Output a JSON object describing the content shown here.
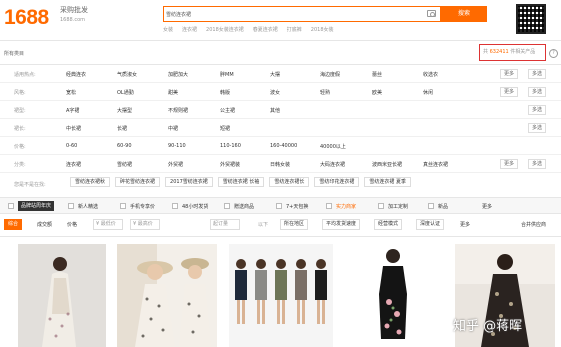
{
  "header": {
    "logo": "1688",
    "logo_sub": "采购批发",
    "logo_url": "1688.com",
    "search_value": "雪纺连衣裙",
    "search_button": "搜索",
    "hot_words": [
      "女装",
      "连衣裙",
      "2018女装连衣裙",
      "春夏连衣裙",
      "打底裤",
      "2018女装"
    ]
  },
  "results": {
    "all_categories": "所有类目",
    "count_prefix": "共",
    "count": "632411",
    "count_suffix": "件相关产品"
  },
  "filters": {
    "more": "更多",
    "multi": "多选",
    "rows": [
      {
        "label": "适用热点:",
        "items": [
          "经典连衣",
          "气质淑女",
          "加肥加大",
          "胖MM",
          "大摆",
          "海边度假",
          "蕾丝",
          "收选衣"
        ],
        "more": true,
        "multi": true
      },
      {
        "label": "风格:",
        "items": [
          "宽松",
          "OL通勤",
          "甜美",
          "韩版",
          "波女",
          "轻熟",
          "欧美",
          "休闲"
        ],
        "more": true,
        "multi": true
      },
      {
        "label": "裙型:",
        "items": [
          "A字裙",
          "大摆型",
          "不规则裙",
          "公主裙",
          "其他"
        ],
        "more": false,
        "multi": true
      },
      {
        "label": "裙长:",
        "items": [
          "中长裙",
          "长裙",
          "中裙",
          "短裙"
        ],
        "more": false,
        "multi": true
      },
      {
        "label": "价格:",
        "items": [
          "0-60",
          "60-90",
          "90-110",
          "110-160",
          "160-40000",
          "40000以上"
        ],
        "more": false,
        "multi": false
      },
      {
        "label": "分类:",
        "items": [
          "连衣裙",
          "雪纺裙",
          "外贸裙",
          "外贸裙装",
          "日韩女装",
          "大码连衣裙",
          "波西米亚长裙",
          "真丝连衣裙"
        ],
        "more": true,
        "multi": true
      }
    ],
    "seen_label": "您是不是在找:",
    "seen_items": [
      "雪纺连衣裙秋",
      "碎花雪纺连衣裙",
      "2017雪纺连衣裙",
      "雪纺连衣裙 长袖",
      "雪纺连衣裙长",
      "雪纺印花连衣裙",
      "雪纺连衣裙 夏季"
    ]
  },
  "services": {
    "badge": "品牌站周年庆",
    "items": [
      "新人精选",
      "手机专享价",
      "48小时发货",
      "赠送商品",
      "7+天包换",
      "实力商家",
      "加工定制",
      "新品"
    ],
    "more": "更多"
  },
  "sort": {
    "active": "综合",
    "items": [
      "成交额",
      "价格"
    ],
    "price_from": "¥ 最低价",
    "price_to": "¥ 最高价",
    "moq": "起订量",
    "moq_suffix": "以下",
    "selects": [
      "所在地区",
      "平均发货速度",
      "经营模式",
      "深度认证"
    ],
    "more": "更多",
    "sellers": "合并供应商"
  },
  "watermark": "知乎 @蒋晖"
}
